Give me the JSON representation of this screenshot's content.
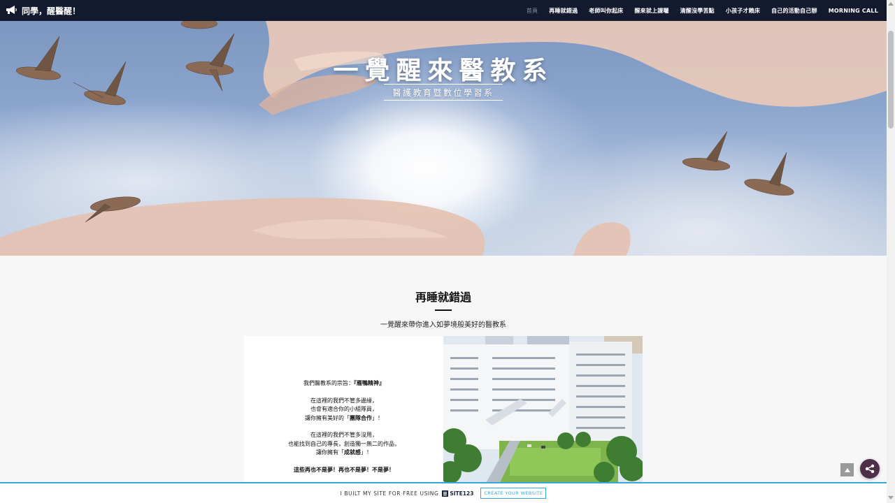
{
  "navbar": {
    "brand_icon": "megaphone-icon",
    "brand_label": "同學，醒醫醒！",
    "items": [
      {
        "label": "首頁",
        "active": true
      },
      {
        "label": "再睡就錯過",
        "active": false
      },
      {
        "label": "老師叫你起床",
        "active": false
      },
      {
        "label": "醒來就上課囉",
        "active": false
      },
      {
        "label": "清醒沒學苦點",
        "active": false
      },
      {
        "label": "小孩子才賴床",
        "active": false
      },
      {
        "label": "自己的活動自己辦",
        "active": false
      },
      {
        "label": "MORNING CALL",
        "active": false
      }
    ]
  },
  "hero": {
    "title": "一覺醒來醫教系",
    "subtitle": "醫護教育暨數位學習系"
  },
  "section": {
    "title": "再睡就錯過",
    "subtitle": "一覺醒來帶你進入如夢境般美好的醫教系"
  },
  "card": {
    "line1_prefix": "我們醫教系的宗旨：",
    "line1_bold": "『雁鴨精神』",
    "p2_line1": "在這裡的我們不管多邊緣，",
    "p2_line2": "也會有適合你的小組隊員，",
    "p2_line3_prefix": "讓你擁有美好的「",
    "p2_line3_bold": "團隊合作",
    "p2_line3_suffix": "」！",
    "p3_line1": "在這裡的我們不管多沒用，",
    "p3_line2": "也能找到自己的專長，創造獨一無二的作品，",
    "p3_line3_prefix": "讓你擁有「",
    "p3_line3_bold": "成就感",
    "p3_line3_suffix": "」！",
    "closing": "這些再也不是夢！再也不是夢！不是夢！"
  },
  "footer": {
    "built_text": "I BUILT MY SITE FOR FREE USING",
    "logo_text": "SITE123",
    "cta": "CREATE YOUR WEBSITE"
  },
  "colors": {
    "navbar_bg": "#141a2e",
    "accent_blue": "#37a6d8",
    "share_button": "#4d2f4a"
  }
}
